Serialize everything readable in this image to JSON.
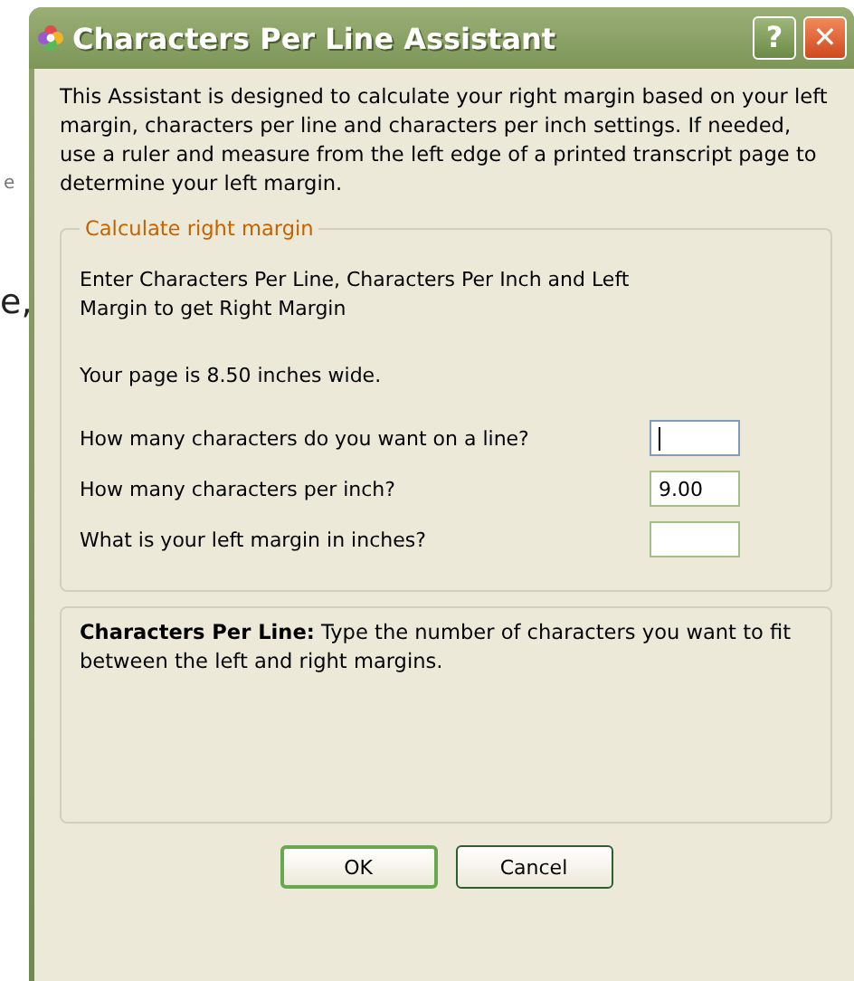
{
  "background_fragments": [
    "e",
    "e,"
  ],
  "window": {
    "title": "Characters Per Line Assistant",
    "help_button": "?",
    "close_button": "✕"
  },
  "intro": "This Assistant is designed to calculate your right margin based on your left margin, characters per line and characters per inch settings. If needed, use a ruler and measure from the left edge of a printed transcript page to determine your left margin.",
  "group": {
    "legend": "Calculate right margin",
    "instruction": "Enter Characters Per Line, Characters Per Inch and Left Margin to get Right Margin",
    "page_info": "Your page is 8.50 inches wide.",
    "fields": [
      {
        "label": "How many characters do you want on a line?",
        "focused": true
      },
      {
        "label": "How many characters per inch?",
        "value": "9.00",
        "focused": false
      },
      {
        "label": "What is your left margin in inches?",
        "focused": false
      }
    ]
  },
  "help": "**Characters Per Line:**  Type the number of characters you want to fit between the left and right margins.",
  "buttons": [
    {
      "label": "OK",
      "default": true
    },
    {
      "label": "Cancel",
      "default": false
    }
  ]
}
